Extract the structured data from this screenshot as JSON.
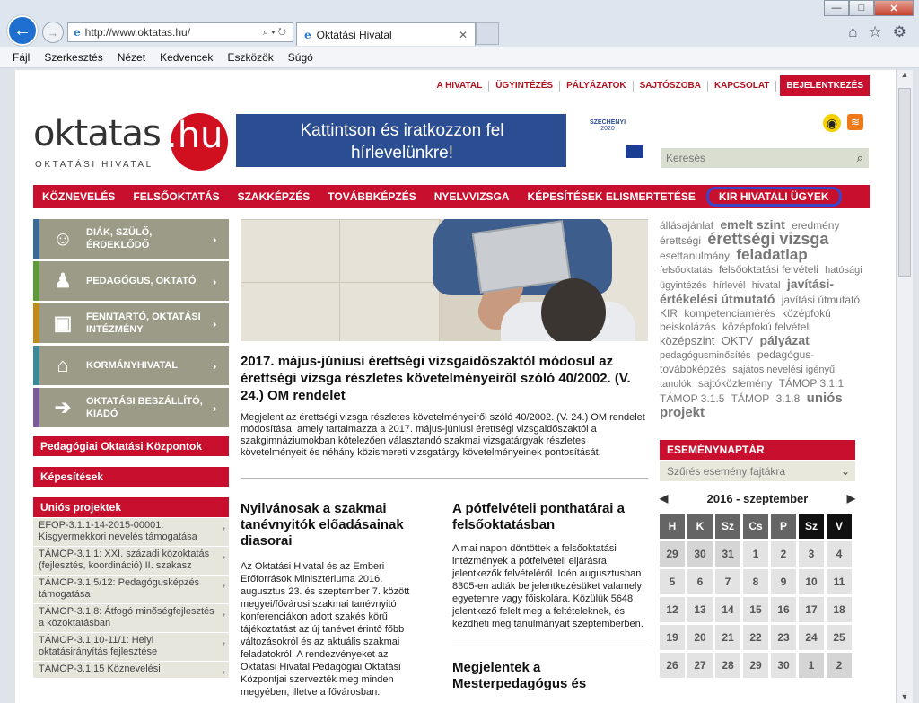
{
  "browser": {
    "url": "http://www.oktatas.hu/",
    "tab_title": "Oktatási Hivatal",
    "menu": [
      "Fájl",
      "Szerkesztés",
      "Nézet",
      "Kedvencek",
      "Eszközök",
      "Súgó"
    ],
    "window_buttons": {
      "minimize": "—",
      "maximize": "□",
      "close": "✕"
    }
  },
  "header": {
    "top_links": [
      "A HIVATAL",
      "ÜGYINTÉZÉS",
      "PÁLYÁZATOK",
      "SAJTÓSZOBA",
      "KAPCSOLAT"
    ],
    "login": "BEJELENTKEZÉS",
    "logo_main": "oktatas",
    "logo_suffix": ".hu",
    "logo_sub": "OKTATÁSI HIVATAL",
    "banner_text": "Kattintson és iratkozzon fel hírlevelünkre!",
    "banner_side": "SZÉCHENYI",
    "banner_side_num": "2020",
    "search_placeholder": "Keresés"
  },
  "nav": [
    "KÖZNEVELÉS",
    "FELSŐOKTATÁS",
    "SZAKKÉPZÉS",
    "TOVÁBBKÉPZÉS",
    "NYELVVIZSGA",
    "KÉPESÍTÉSEK ELISMERTETÉSE",
    "KIR HIVATALI ÜGYEK"
  ],
  "sidebar": {
    "tiles": [
      {
        "label": "DIÁK, SZÜLŐ, ÉRDEKLŐDŐ",
        "color": "#3a6a9a",
        "bg": "#9b9b88"
      },
      {
        "label": "PEDAGÓGUS, OKTATÓ",
        "color": "#5f9a3a",
        "bg": "#9b9b88"
      },
      {
        "label": "FENNTARTÓ, OKTATÁSI INTÉZMÉNY",
        "color": "#c28a1a",
        "bg": "#9b9b88"
      },
      {
        "label": "KORMÁNYHIVATAL",
        "color": "#3a8a9a",
        "bg": "#9b9b88"
      },
      {
        "label": "OKTATÁSI BESZÁLLÍTÓ, KIADÓ",
        "color": "#7a5a9a",
        "bg": "#9b9b88"
      }
    ],
    "boxes": [
      "Pedagógiai Oktatási Központok",
      "Képesítések",
      "Uniós projektek"
    ],
    "projects": [
      "EFOP-3.1.1-14-2015-00001: Kisgyermekkori nevelés támogatása",
      "TÁMOP-3.1.1: XXI. századi közoktatás (fejlesztés, koordináció) II. szakasz",
      "TÁMOP-3.1.5/12: Pedagógusképzés támogatása",
      "TÁMOP-3.1.8: Átfogó minőségfejlesztés a közoktatásban",
      "TÁMOP-3.1.10-11/1: Helyi oktatásirányítás fejlesztése",
      "TÁMOP-3.1.15 Köznevelési"
    ]
  },
  "main": {
    "headline": "2017. május-júniusi érettségi vizsgaidőszaktól módosul az érettségi vizsga részletes követelményeiről szóló 40/2002. (V. 24.) OM rendelet",
    "lead": "Megjelent az érettségi vizsga részletes követelményeiről szóló 40/2002. (V. 24.) OM rendelet módosítása, amely tartalmazza a 2017. május-júniusi érettségi vizsgaidőszaktól a szakgimnáziumokban kötelezően választandó szakmai vizsgatárgyak részletes követelményeit és néhány közismereti vizsgatárgy követelményeinek pontosítását.",
    "col1_title": "Nyilvánosak a szakmai tanévnyitók előadásainak diasorai",
    "col1_text": "Az Oktatási Hivatal és az Emberi Erőforrások Minisztériuma 2016. augusztus 23. és szeptember 7. között megyei/fővárosi szakmai tanévnyitó konferenciákon adott szakés körű tájékoztatást az új tanévet érintő főbb változásokról és az aktuális szakmai feladatokról. A rendezvényeket az Oktatási Hivatal Pedagógiai Oktatási Központjai szervezték meg minden megyében, illetve a fővárosban.",
    "col2_title": "A pótfelvételi ponthatárai a felsőoktatásban",
    "col2_text": "A mai napon döntöttek a felsőoktatási intézmények a pótfelvételi eljárásra jelentkezők felvételéről. Idén augusztusban 8305-en adták be jelentkezésüket valamely egyetemre vagy főiskolára. Közülük 5648 jelentkező felelt meg a feltételeknek, és kezdheti meg tanulmányait szeptemberben.",
    "col2b_title": "Megjelentek a Mesterpedagógus és"
  },
  "tags": [
    {
      "t": "állásajánlat",
      "s": 12
    },
    {
      "t": "emelt szint",
      "s": 14
    },
    {
      "t": "eredmény",
      "s": 12
    },
    {
      "t": "érettségi",
      "s": 12
    },
    {
      "t": "érettségi vizsga",
      "s": 18
    },
    {
      "t": "esettanulmány",
      "s": 12
    },
    {
      "t": "feladatlap",
      "s": 17
    },
    {
      "t": "felsőoktatás",
      "s": 11
    },
    {
      "t": "felsőoktatási felvételi",
      "s": 12
    },
    {
      "t": "hatósági ügyintézés",
      "s": 11
    },
    {
      "t": "hírlevél",
      "s": 11
    },
    {
      "t": "hivatal",
      "s": 11
    },
    {
      "t": "javítási-értékelési útmutató",
      "s": 14
    },
    {
      "t": "javítási útmutató",
      "s": 12
    },
    {
      "t": "KIR",
      "s": 12
    },
    {
      "t": "kompetenciamérés",
      "s": 12
    },
    {
      "t": "középfokú",
      "s": 12
    },
    {
      "t": "beiskolázás",
      "s": 12
    },
    {
      "t": "középfokú felvételi",
      "s": 12
    },
    {
      "t": "középszint",
      "s": 13
    },
    {
      "t": "OKTV",
      "s": 13
    },
    {
      "t": "pályázat",
      "s": 14
    },
    {
      "t": "pedagógusminősítés",
      "s": 11
    },
    {
      "t": "pedagógus-továbbképzés",
      "s": 12
    },
    {
      "t": "sajátos nevelési igényű",
      "s": 11
    },
    {
      "t": "tanulók",
      "s": 11
    },
    {
      "t": "sajtóközlemény",
      "s": 12
    },
    {
      "t": "TÁMOP 3.1.1",
      "s": 12
    },
    {
      "t": "TÁMOP 3.1.5",
      "s": 12
    },
    {
      "t": "TÁMOP",
      "s": 12
    },
    {
      "t": "3.1.8",
      "s": 12
    },
    {
      "t": "uniós projekt",
      "s": 15
    }
  ],
  "events": {
    "title": "ESEMÉNYNAPTÁR",
    "filter": "Szűrés esemény fajtákra",
    "month": "2016 - szeptember",
    "days": [
      "H",
      "K",
      "Sz",
      "Cs",
      "P",
      "Sz",
      "V"
    ],
    "weeks": [
      [
        "29",
        "30",
        "31",
        "1",
        "2",
        "3",
        "4"
      ],
      [
        "5",
        "6",
        "7",
        "8",
        "9",
        "10",
        "11"
      ],
      [
        "12",
        "13",
        "14",
        "15",
        "16",
        "17",
        "18"
      ],
      [
        "19",
        "20",
        "21",
        "22",
        "23",
        "24",
        "25"
      ],
      [
        "26",
        "27",
        "28",
        "29",
        "30",
        "1",
        "2"
      ]
    ]
  }
}
